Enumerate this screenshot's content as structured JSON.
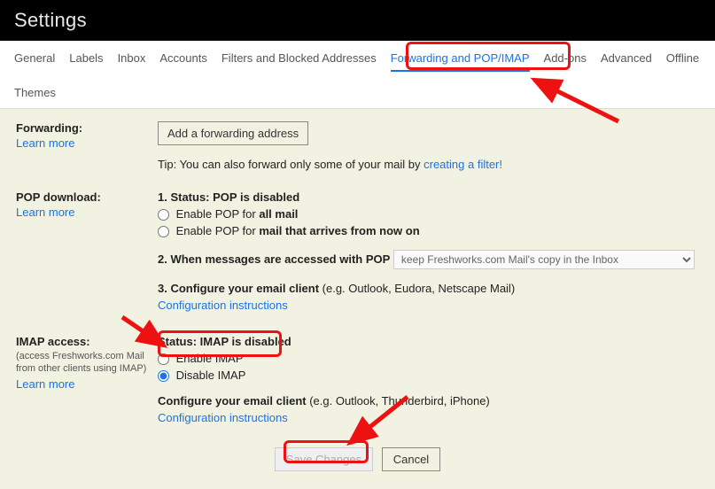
{
  "titlebar": "Settings",
  "tabs": {
    "general": "General",
    "labels": "Labels",
    "inbox": "Inbox",
    "accounts": "Accounts",
    "filters": "Filters and Blocked Addresses",
    "forwarding": "Forwarding and POP/IMAP",
    "addons": "Add-ons",
    "advanced": "Advanced",
    "offline": "Offline",
    "themes": "Themes"
  },
  "forwarding": {
    "label": "Forwarding:",
    "learn": "Learn more",
    "add_btn": "Add a forwarding address",
    "tip_prefix": "Tip: You can also forward only some of your mail by ",
    "tip_link": "creating a filter!"
  },
  "pop": {
    "label": "POP download:",
    "learn": "Learn more",
    "status_prefix": "1. Status: ",
    "status_value": "POP is disabled",
    "enable_all_prefix": "Enable POP for ",
    "enable_all_bold": "all mail",
    "enable_new_prefix": "Enable POP for ",
    "enable_new_bold": "mail that arrives from now on",
    "step2": "2. When messages are accessed with POP",
    "select_value": "keep Freshworks.com Mail's copy in the Inbox",
    "step3_bold": "3. Configure your email client",
    "step3_rest": " (e.g. Outlook, Eudora, Netscape Mail)",
    "config_link": "Configuration instructions"
  },
  "imap": {
    "label": "IMAP access:",
    "sub": "(access Freshworks.com Mail from other clients using IMAP)",
    "learn": "Learn more",
    "status": "Status: IMAP is disabled",
    "enable": "Enable IMAP",
    "disable": "Disable IMAP",
    "config_bold": "Configure your email client",
    "config_rest": " (e.g. Outlook, Thunderbird, iPhone)",
    "config_link": "Configuration instructions"
  },
  "footer": {
    "save": "Save Changes",
    "cancel": "Cancel"
  }
}
